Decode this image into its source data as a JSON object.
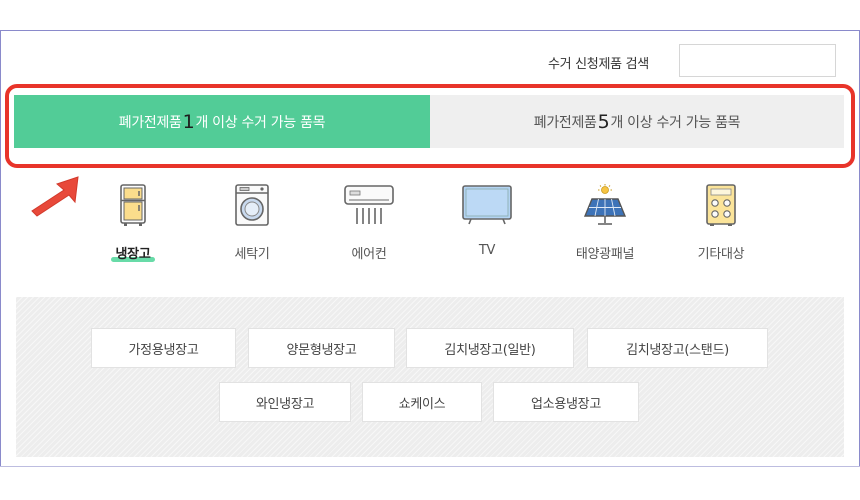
{
  "search": {
    "label": "수거 신청제품 검색",
    "value": ""
  },
  "tabs": [
    {
      "prefix": "폐가전제품 ",
      "count": "1",
      "suffix": "개 이상 수거 가능 품목",
      "active": true
    },
    {
      "prefix": "폐가전제품 ",
      "count": "5",
      "suffix": "개 이상 수거 가능 품목",
      "active": false
    }
  ],
  "categories": [
    {
      "label": "냉장고",
      "icon": "refrigerator-icon",
      "active": true
    },
    {
      "label": "세탁기",
      "icon": "washing-machine-icon"
    },
    {
      "label": "에어컨",
      "icon": "air-conditioner-icon"
    },
    {
      "label": "TV",
      "icon": "tv-icon"
    },
    {
      "label": "태양광패널",
      "icon": "solar-panel-icon"
    },
    {
      "label": "기타대상",
      "icon": "other-appliance-icon"
    }
  ],
  "subcategories": [
    "가정용냉장고",
    "양문형냉장고",
    "김치냉장고(일반)",
    "김치냉장고(스탠드)",
    "와인냉장고",
    "쇼케이스",
    "업소용냉장고"
  ],
  "colors": {
    "accent": "#52cc97",
    "highlight": "#e8342a",
    "inactive_tab": "#efefef"
  }
}
